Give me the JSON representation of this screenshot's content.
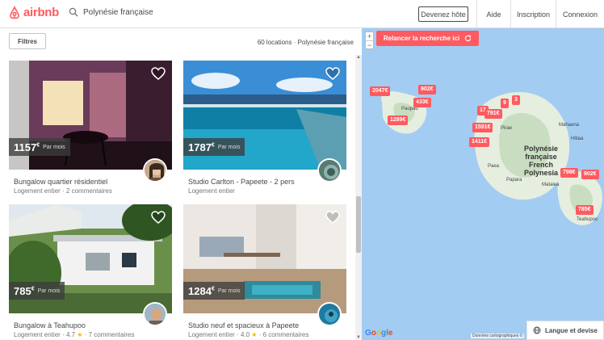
{
  "header": {
    "logo": "airbnb",
    "search_value": "Polynésie française",
    "host_button": "Devenez hôte",
    "nav": [
      "Aide",
      "Inscription",
      "Connexion"
    ]
  },
  "list": {
    "filters_label": "Filtres",
    "count_text": "60 locations · Polynésie française",
    "cards": [
      {
        "price": "1157",
        "currency": "€",
        "per": "Par mois",
        "title": "Bungalow quartier résidentiel",
        "subtitle": "Logement entier · 2 commentaires",
        "rating": "",
        "reviews": ""
      },
      {
        "price": "1787",
        "currency": "€",
        "per": "Par mois",
        "title": "Studio Carlton - Papeete - 2 pers",
        "subtitle": "Logement entier",
        "rating": "",
        "reviews": ""
      },
      {
        "price": "785",
        "currency": "€",
        "per": "Par mois",
        "title": "Bungalow à Teahupoo",
        "subtitle": "Logement entier · ",
        "rating": "4.7",
        "reviews": " · 7 commentaires"
      },
      {
        "price": "1284",
        "currency": "€",
        "per": "Par mois",
        "title": "Studio neuf et spacieux à Papeete",
        "subtitle": "Logement entier · ",
        "rating": "4.0",
        "reviews": " · 6 commentaires"
      }
    ]
  },
  "map": {
    "rerun_label": "Relancer la recherche ici",
    "zoom_in": "+",
    "zoom_out": "−",
    "pins": [
      "2047€",
      "902€",
      "433€",
      "1289€",
      "17",
      "9",
      "3",
      "791€",
      "1591€",
      "1411€",
      "798€",
      "902€",
      "785€"
    ],
    "labels": {
      "paopao": "Paopao",
      "pirae": "Pirae",
      "mahaena": "Mahaena",
      "hitiaa": "Hitiaa",
      "paea": "Paea",
      "papara": "Papara",
      "mataiea": "Mataiea",
      "teahupoo": "Teahupoo",
      "region": "Polynésie française French Polynesia"
    },
    "google": "Google",
    "mapdata": "Données cartographiques ©",
    "lang_button": "Langue et devise"
  }
}
